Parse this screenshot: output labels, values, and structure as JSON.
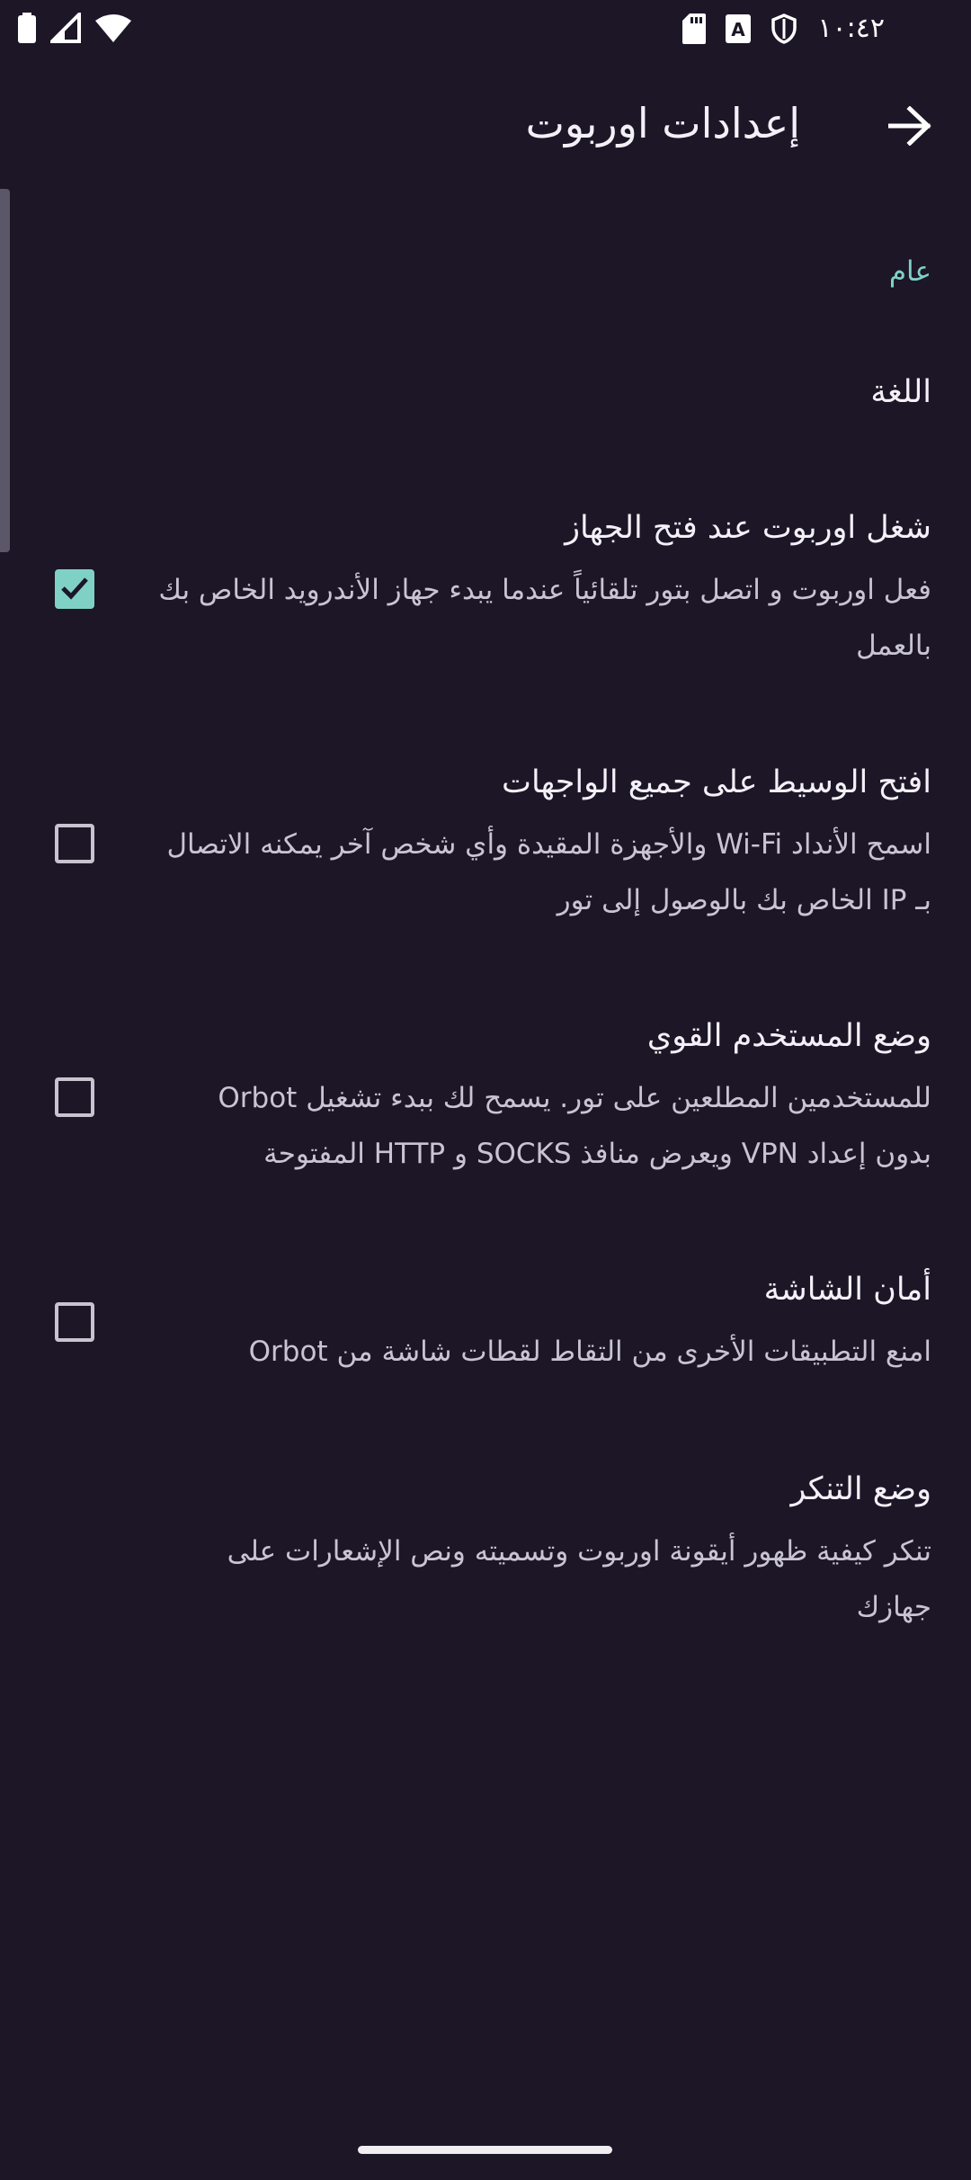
{
  "status_bar": {
    "time": "١٠:٤٢",
    "icons": [
      "battery-icon",
      "signal-icon",
      "wifi-icon",
      "sd-card-icon",
      "keyboard-a-icon",
      "vpn-shield-icon"
    ]
  },
  "app_bar": {
    "title": "إعدادات اوربوت",
    "back_icon": "arrow-back-icon"
  },
  "section": {
    "header": "عام"
  },
  "preferences": [
    {
      "title": "اللغة"
    },
    {
      "title": "شغل اوربوت عند فتح الجهاز",
      "summary": "فعل اوربوت و اتصل بتور تلقائياً عندما يبدء جهاز الأندرويد الخاص بك بالعمل",
      "checked": true
    },
    {
      "title": "افتح الوسيط على جميع الواجهات",
      "summary": "اسمح الأنداد Wi-Fi والأجهزة المقيدة وأي شخص آخر يمكنه الاتصال بـ IP الخاص بك بالوصول إلى تور",
      "checked": false
    },
    {
      "title": "وضع المستخدم القوي",
      "summary": "للمستخدمين المطلعين على تور. يسمح لك ببدء تشغيل Orbot بدون إعداد VPN ويعرض منافذ SOCKS و HTTP المفتوحة",
      "checked": false
    },
    {
      "title": "أمان الشاشة",
      "summary": "امنع التطبيقات الأخرى من التقاط لقطات شاشة من Orbot",
      "checked": false
    },
    {
      "title": "وضع التنكر",
      "summary": "تنكر كيفية ظهور أيقونة اوربوت وتسميته ونص الإشعارات على جهازك"
    }
  ],
  "colors": {
    "background": "#1c1627",
    "accent": "#7fd1c6",
    "text_primary": "#f3f0f7",
    "text_secondary": "#c9c4d2"
  }
}
